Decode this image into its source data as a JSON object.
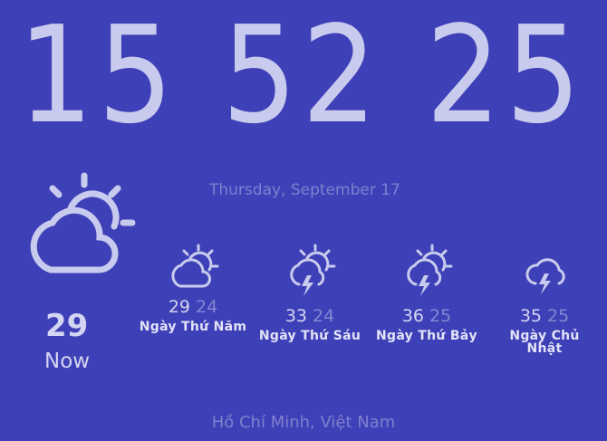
{
  "clock": {
    "hours": "15",
    "minutes": "52",
    "seconds": "25"
  },
  "date": "Thursday, September 17",
  "current": {
    "temp": "29",
    "label": "Now",
    "icon": "partly-cloudy-day-icon"
  },
  "forecast": [
    {
      "high": "29",
      "low": "24",
      "day": "Ngày Thứ Năm",
      "icon": "partly-cloudy-day-icon"
    },
    {
      "high": "33",
      "low": "24",
      "day": "Ngày Thứ Sáu",
      "icon": "thunderstorm-sun-icon"
    },
    {
      "high": "36",
      "low": "25",
      "day": "Ngày Thứ Bảy",
      "icon": "thunderstorm-sun-icon"
    },
    {
      "high": "35",
      "low": "25",
      "day": "Ngày Chủ Nhật",
      "icon": "thunderstorm-icon"
    }
  ],
  "location": "Hồ Chí Minh, Việt Nam",
  "colors": {
    "background": "#3e40b7",
    "foreground": "#c9cbee",
    "muted": "#7e80cf"
  }
}
